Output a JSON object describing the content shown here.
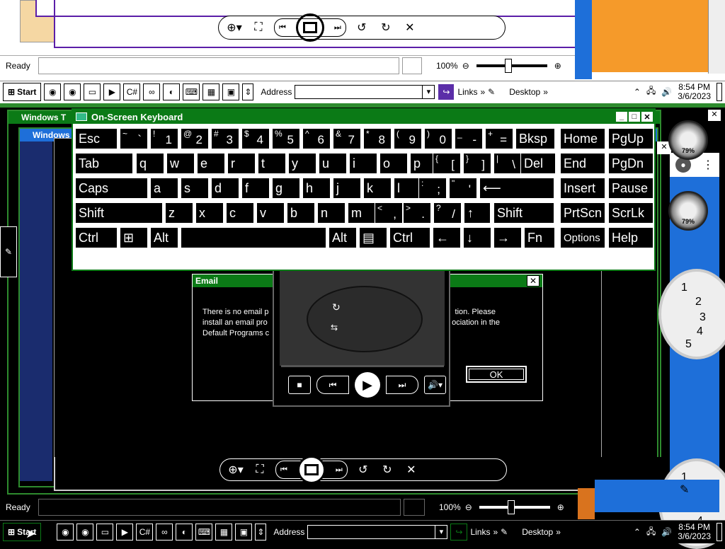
{
  "top_window": {
    "status": "Ready",
    "zoom": "100%"
  },
  "top_taskbar": {
    "start": "Start",
    "address_label": "Address",
    "links": "Links",
    "desktop": "Desktop",
    "time": "8:54 PM",
    "date": "3/6/2023"
  },
  "bottom_taskbar": {
    "start": "Start",
    "address_label": "Address",
    "links": "Links",
    "desktop": "Desktop",
    "time": "8:54 PM",
    "date": "3/6/2023"
  },
  "bottom_window": {
    "status": "Ready",
    "zoom": "100%"
  },
  "back_windows": {
    "title1": "Windows T",
    "title2": "Windows"
  },
  "osk": {
    "title": "On-Screen Keyboard",
    "rows": [
      [
        {
          "shift": "",
          "main": "Esc"
        },
        {
          "shift": "~",
          "main": "`"
        },
        {
          "shift": "!",
          "main": "1"
        },
        {
          "shift": "@",
          "main": "2"
        },
        {
          "shift": "#",
          "main": "3"
        },
        {
          "shift": "$",
          "main": "4"
        },
        {
          "shift": "%",
          "main": "5"
        },
        {
          "shift": "^",
          "main": "6"
        },
        {
          "shift": "&",
          "main": "7"
        },
        {
          "shift": "*",
          "main": "8"
        },
        {
          "shift": "(",
          "main": "9"
        },
        {
          "shift": ")",
          "main": "0"
        },
        {
          "shift": "_",
          "main": "-"
        },
        {
          "shift": "+",
          "main": "="
        },
        {
          "shift": "",
          "main": "Bksp"
        },
        {
          "shift": "",
          "main": "Home"
        },
        {
          "shift": "",
          "main": "PgUp"
        }
      ],
      [
        {
          "shift": "",
          "main": "Tab"
        },
        {
          "shift": "",
          "main": "q"
        },
        {
          "shift": "",
          "main": "w"
        },
        {
          "shift": "",
          "main": "e"
        },
        {
          "shift": "",
          "main": "r"
        },
        {
          "shift": "",
          "main": "t"
        },
        {
          "shift": "",
          "main": "y"
        },
        {
          "shift": "",
          "main": "u"
        },
        {
          "shift": "",
          "main": "i"
        },
        {
          "shift": "",
          "main": "o"
        },
        {
          "shift": "",
          "main": "p"
        },
        {
          "shift": "{",
          "main": "["
        },
        {
          "shift": "}",
          "main": "]"
        },
        {
          "shift": "|",
          "main": "\\"
        },
        {
          "shift": "",
          "main": "Del"
        },
        {
          "shift": "",
          "main": "End"
        },
        {
          "shift": "",
          "main": "PgDn"
        }
      ],
      [
        {
          "shift": "",
          "main": "Caps"
        },
        {
          "shift": "",
          "main": "a"
        },
        {
          "shift": "",
          "main": "s"
        },
        {
          "shift": "",
          "main": "d"
        },
        {
          "shift": "",
          "main": "f"
        },
        {
          "shift": "",
          "main": "g"
        },
        {
          "shift": "",
          "main": "h"
        },
        {
          "shift": "",
          "main": "j"
        },
        {
          "shift": "",
          "main": "k"
        },
        {
          "shift": "",
          "main": "l"
        },
        {
          "shift": ":",
          "main": ";"
        },
        {
          "shift": "\"",
          "main": "'"
        },
        {
          "shift": "",
          "main": "⟵"
        },
        {
          "shift": "",
          "main": "Insert"
        },
        {
          "shift": "",
          "main": "Pause"
        }
      ],
      [
        {
          "shift": "",
          "main": "Shift"
        },
        {
          "shift": "",
          "main": "z"
        },
        {
          "shift": "",
          "main": "x"
        },
        {
          "shift": "",
          "main": "c"
        },
        {
          "shift": "",
          "main": "v"
        },
        {
          "shift": "",
          "main": "b"
        },
        {
          "shift": "",
          "main": "n"
        },
        {
          "shift": "",
          "main": "m"
        },
        {
          "shift": "<",
          "main": ","
        },
        {
          "shift": ">",
          "main": "."
        },
        {
          "shift": "?",
          "main": "/"
        },
        {
          "shift": "",
          "main": "↑"
        },
        {
          "shift": "",
          "main": "Shift"
        },
        {
          "shift": "",
          "main": "PrtScn"
        },
        {
          "shift": "",
          "main": "ScrLk"
        }
      ],
      [
        {
          "shift": "",
          "main": "Ctrl"
        },
        {
          "shift": "",
          "main": "⊞"
        },
        {
          "shift": "",
          "main": "Alt"
        },
        {
          "shift": "",
          "main": ""
        },
        {
          "shift": "",
          "main": "Alt"
        },
        {
          "shift": "",
          "main": "▤"
        },
        {
          "shift": "",
          "main": "Ctrl"
        },
        {
          "shift": "",
          "main": "←"
        },
        {
          "shift": "",
          "main": "↓"
        },
        {
          "shift": "",
          "main": "→"
        },
        {
          "shift": "",
          "main": "Fn"
        },
        {
          "shift": "",
          "main": "Options"
        },
        {
          "shift": "",
          "main": "Help"
        }
      ]
    ]
  },
  "email_dialog": {
    "title": "Email",
    "line1_a": "There is no email p",
    "line1_b": "tion. Please",
    "line2_a": "install an email pro",
    "line2_b": "ociation in the",
    "line3_a": "Default Programs c",
    "ok": "OK"
  },
  "gadgets": {
    "gauge1": "79%",
    "gauge2": "79%",
    "clock_numbers": [
      "1",
      "2",
      "3",
      "4",
      "5"
    ]
  }
}
